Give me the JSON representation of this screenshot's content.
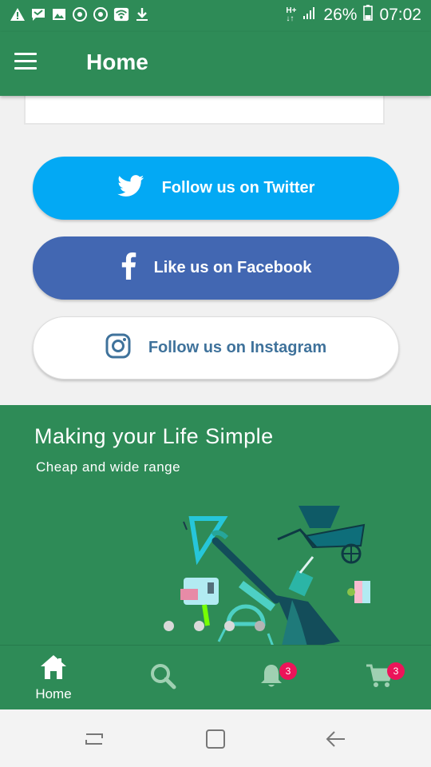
{
  "status_bar": {
    "network_top": "H+",
    "network_bottom": "↓↑",
    "battery_percent": "26%",
    "time": "07:02",
    "left_icons": [
      "warning-icon",
      "message-icon",
      "image-icon",
      "sync-icon",
      "sync-icon",
      "wifi-icon",
      "download-icon"
    ]
  },
  "app_bar": {
    "title": "Home"
  },
  "social": {
    "twitter_label": "Follow us on Twitter",
    "facebook_label": "Like us on Facebook",
    "instagram_label": "Follow us on Instagram",
    "colors": {
      "twitter": "#03a9f4",
      "facebook": "#4267b2",
      "instagram_text": "#3f729b"
    }
  },
  "banner": {
    "title": "Making your Life Simple",
    "subtitle": "Cheap and wide range",
    "slides_count": 4,
    "active_slide": 3
  },
  "bottom_nav": {
    "home_label": "Home",
    "notifications_badge": "3",
    "cart_badge": "3"
  },
  "theme": {
    "primary": "#2e8b57",
    "badge": "#ec1459"
  }
}
